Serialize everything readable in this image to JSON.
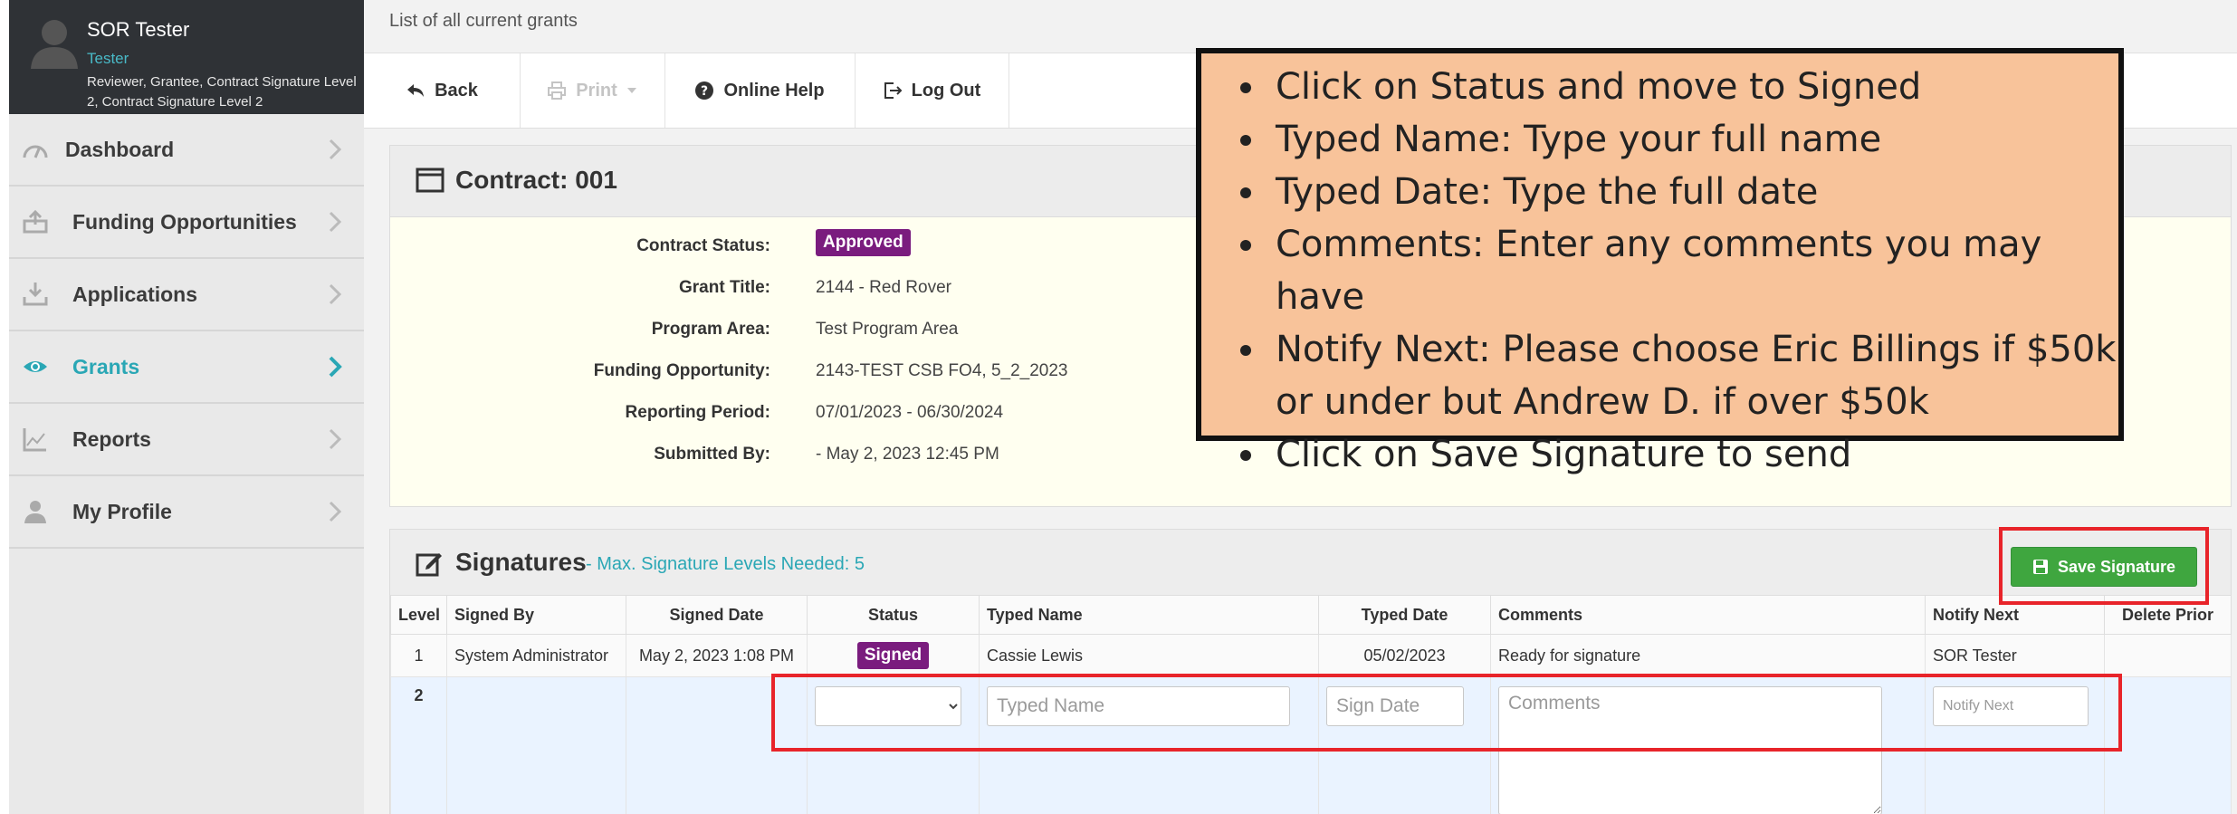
{
  "user": {
    "name": "SOR Tester",
    "role": "Tester",
    "permissions": "Reviewer, Grantee, Contract Signature Level 2, Contract Signature Level 2"
  },
  "sidebar": {
    "items": [
      {
        "label": "Dashboard",
        "icon": "dashboard-gauge-icon"
      },
      {
        "label": "Funding Opportunities",
        "icon": "upload-tray-icon"
      },
      {
        "label": "Applications",
        "icon": "download-tray-icon"
      },
      {
        "label": "Grants",
        "icon": "eye-icon",
        "active": true
      },
      {
        "label": "Reports",
        "icon": "line-chart-icon"
      },
      {
        "label": "My Profile",
        "icon": "user-icon"
      }
    ]
  },
  "main": {
    "heading": "List of all current grants"
  },
  "toolbar": {
    "back": "Back",
    "print": "Print",
    "help": "Online Help",
    "logout": "Log Out"
  },
  "contract": {
    "title": "Contract: 001",
    "fields": [
      {
        "label": "Contract Status:",
        "value": "Approved",
        "badge": true
      },
      {
        "label": "Grant Title:",
        "value": "2144 - Red Rover"
      },
      {
        "label": "Program Area:",
        "value": "Test Program Area"
      },
      {
        "label": "Funding Opportunity:",
        "value": "2143-TEST CSB FO4, 5_2_2023"
      },
      {
        "label": "Reporting Period:",
        "value": "07/01/2023 - 06/30/2024"
      },
      {
        "label": "Submitted By:",
        "value": "- May 2, 2023 12:45 PM"
      }
    ]
  },
  "signatures": {
    "title": "Signatures",
    "subtitle": "- Max. Signature Levels Needed: 5",
    "save_label": "Save Signature",
    "columns": [
      "Level",
      "Signed By",
      "Signed Date",
      "Status",
      "Typed Name",
      "Typed Date",
      "Comments",
      "Notify Next",
      "Delete Prior"
    ],
    "rows": [
      {
        "level": "1",
        "signed_by": "System Administrator",
        "signed_date": "May 2, 2023 1:08 PM",
        "status": "Signed",
        "typed_name": "Cassie Lewis",
        "typed_date": "05/02/2023",
        "comments": "Ready for signature",
        "notify_next": "SOR Tester"
      }
    ],
    "new_row": {
      "level": "2",
      "typed_name_placeholder": "Typed Name",
      "sign_date_placeholder": "Sign Date",
      "comments_placeholder": "Comments",
      "notify_next_placeholder": "Notify Next"
    }
  },
  "callout": {
    "lines": [
      "Click on Status and move to Signed",
      "Typed Name: Type your full name",
      "Typed Date: Type the full date",
      "Comments: Enter any comments you may have",
      "Notify Next: Please choose Eric Billings if $50k or under but Andrew D. if over $50k",
      "Click on Save Signature to send"
    ]
  },
  "colors": {
    "accent": "#2aa7b5",
    "badge": "#7a1c7e",
    "save": "#3fa63f",
    "annotation": "#e8242a",
    "callout_bg": "#f8c39a"
  }
}
